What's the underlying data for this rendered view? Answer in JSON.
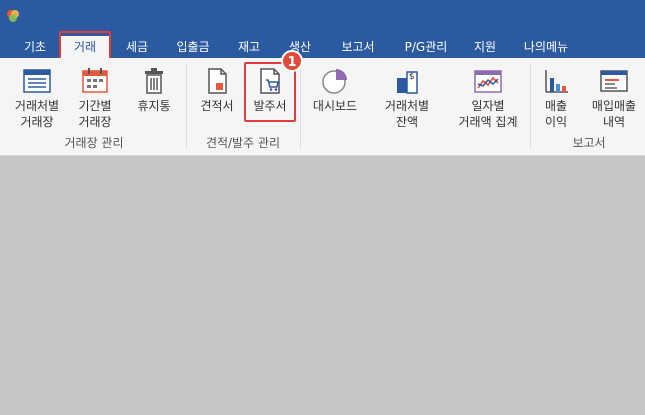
{
  "menu": {
    "tabs": [
      {
        "label": "기초"
      },
      {
        "label": "거래"
      },
      {
        "label": "세금"
      },
      {
        "label": "입출금"
      },
      {
        "label": "재고"
      },
      {
        "label": "생산"
      },
      {
        "label": "보고서"
      },
      {
        "label": "P/G관리"
      },
      {
        "label": "지원"
      },
      {
        "label": "나의메뉴"
      }
    ],
    "active_tab": "거래"
  },
  "ribbon": {
    "groups": [
      {
        "label": "거래장 관리",
        "buttons": [
          "거래처별\n거래장",
          "기간별\n거래장",
          "휴지통"
        ]
      },
      {
        "label": "견적/발주 관리",
        "buttons": [
          "견적서",
          "발주서"
        ]
      },
      {
        "label": "",
        "buttons": [
          "대시보드",
          "거래처별\n잔액",
          "일자별\n거래액 집계"
        ]
      },
      {
        "label": "보고서",
        "buttons": [
          "매출\n이익",
          "매입매출\n내역"
        ]
      }
    ]
  },
  "annotation": {
    "step": "1"
  },
  "colors": {
    "accent": "#2b5aa0",
    "highlight": "#e03c3c",
    "workspace": "#c5c5c5"
  }
}
